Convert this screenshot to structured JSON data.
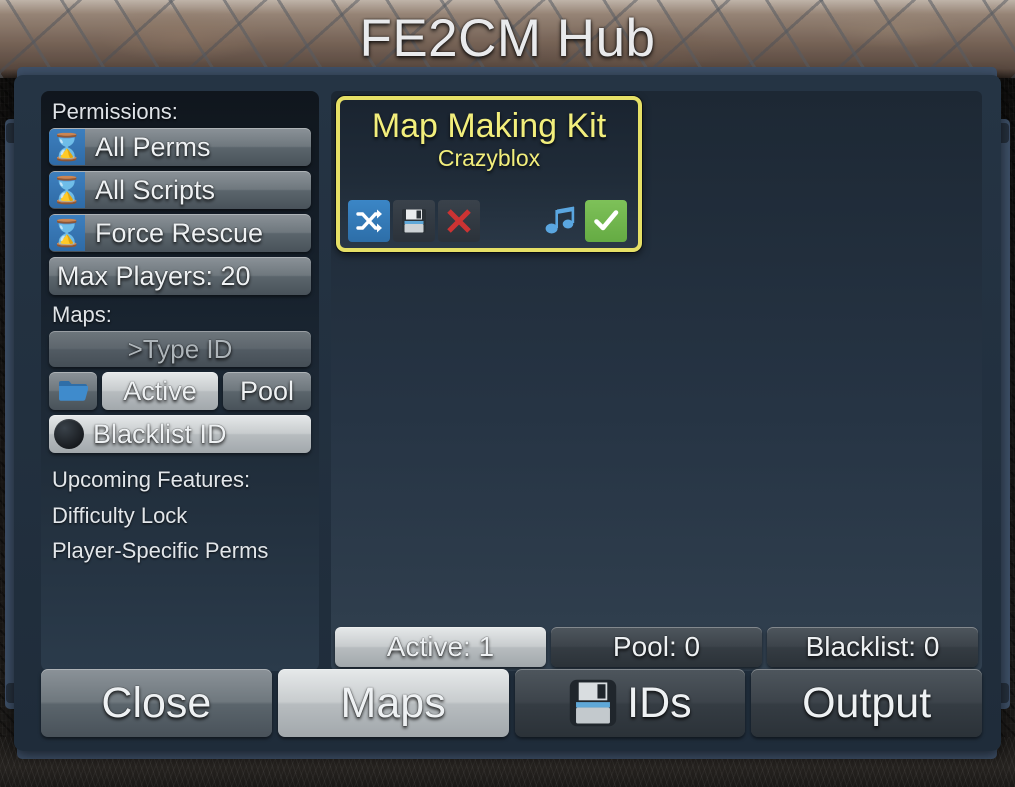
{
  "window": {
    "title": "FE2CM Hub"
  },
  "sidebar": {
    "permissions_label": "Permissions:",
    "permissions": [
      {
        "icon": "hourglass-icon",
        "label": "All Perms"
      },
      {
        "icon": "hourglass-icon",
        "label": "All Scripts"
      },
      {
        "icon": "hourglass-icon",
        "label": "Force Rescue"
      }
    ],
    "max_players": "Max Players: 20",
    "maps_label": "Maps:",
    "type_id_placeholder": ">Type ID",
    "folder_icon": "folder-icon",
    "active_label": "Active",
    "pool_label": "Pool",
    "blacklist_icon": "black-circle-icon",
    "blacklist_label": "Blacklist ID",
    "upcoming": [
      "Upcoming Features:",
      "Difficulty Lock",
      "Player-Specific Perms"
    ]
  },
  "main": {
    "cards": [
      {
        "title": "Map Making Kit",
        "author": "Crazyblox",
        "border_color": "#e6e066",
        "title_color": "#f2ee7c",
        "actions": [
          {
            "icon": "shuffle-icon",
            "style": "shuffle"
          },
          {
            "icon": "save-floppy-icon",
            "style": "dark"
          },
          {
            "icon": "delete-x-icon",
            "style": "dark"
          },
          {
            "icon": "music-note-icon",
            "style": "plain"
          },
          {
            "icon": "confirm-check-icon",
            "style": "green"
          }
        ]
      }
    ],
    "status": [
      {
        "label": "Active: 1",
        "selected": true
      },
      {
        "label": "Pool: 0",
        "selected": false
      },
      {
        "label": "Blacklist: 0",
        "selected": false
      }
    ]
  },
  "bottom_nav": [
    {
      "label": "Close",
      "icon": null,
      "selected": false
    },
    {
      "label": "Maps",
      "icon": null,
      "selected": true
    },
    {
      "label": "IDs",
      "icon": "floppy-disk-icon",
      "selected": false
    },
    {
      "label": "Output",
      "icon": null,
      "selected": false
    }
  ],
  "colors": {
    "accent_yellow": "#e6e066",
    "accent_blue": "#3b86c6",
    "accent_green": "#7ec159",
    "accent_red": "#cc3333",
    "frame_blue": "#3e5068",
    "panel_dark": "#1d2834"
  }
}
